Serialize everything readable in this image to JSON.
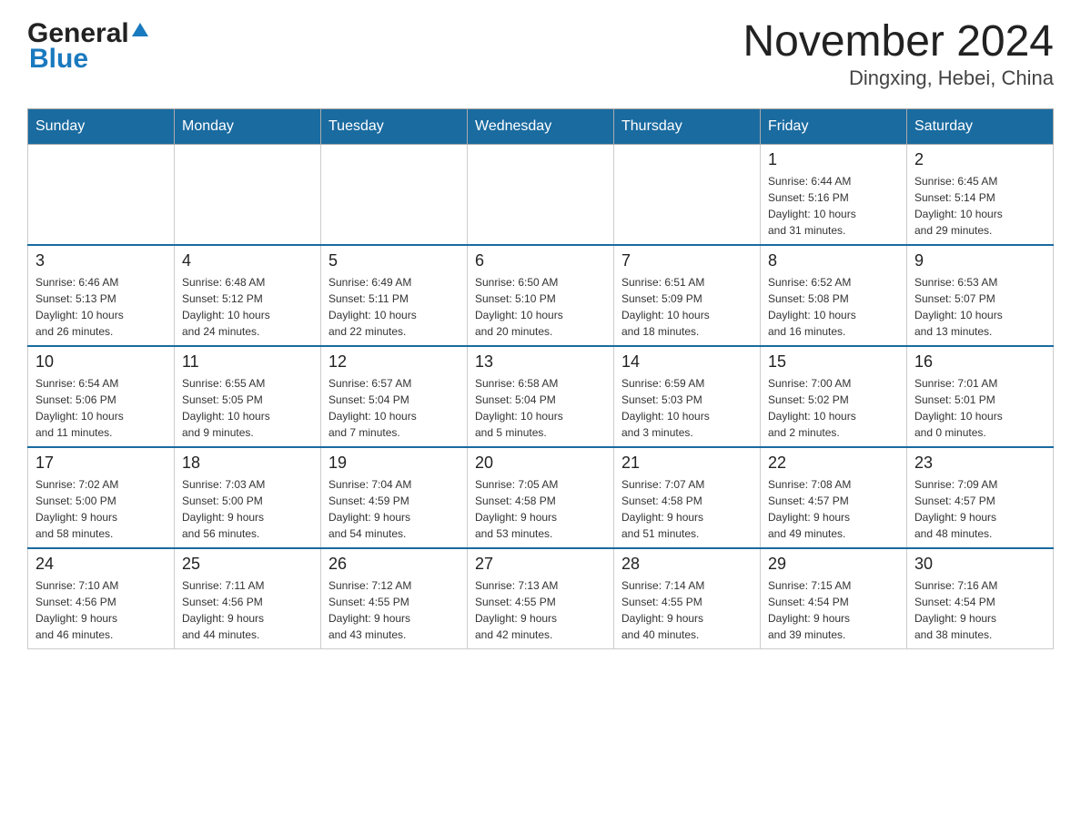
{
  "logo": {
    "general": "General",
    "blue": "Blue"
  },
  "title": "November 2024",
  "subtitle": "Dingxing, Hebei, China",
  "weekdays": [
    "Sunday",
    "Monday",
    "Tuesday",
    "Wednesday",
    "Thursday",
    "Friday",
    "Saturday"
  ],
  "weeks": [
    [
      {
        "day": "",
        "info": ""
      },
      {
        "day": "",
        "info": ""
      },
      {
        "day": "",
        "info": ""
      },
      {
        "day": "",
        "info": ""
      },
      {
        "day": "",
        "info": ""
      },
      {
        "day": "1",
        "info": "Sunrise: 6:44 AM\nSunset: 5:16 PM\nDaylight: 10 hours\nand 31 minutes."
      },
      {
        "day": "2",
        "info": "Sunrise: 6:45 AM\nSunset: 5:14 PM\nDaylight: 10 hours\nand 29 minutes."
      }
    ],
    [
      {
        "day": "3",
        "info": "Sunrise: 6:46 AM\nSunset: 5:13 PM\nDaylight: 10 hours\nand 26 minutes."
      },
      {
        "day": "4",
        "info": "Sunrise: 6:48 AM\nSunset: 5:12 PM\nDaylight: 10 hours\nand 24 minutes."
      },
      {
        "day": "5",
        "info": "Sunrise: 6:49 AM\nSunset: 5:11 PM\nDaylight: 10 hours\nand 22 minutes."
      },
      {
        "day": "6",
        "info": "Sunrise: 6:50 AM\nSunset: 5:10 PM\nDaylight: 10 hours\nand 20 minutes."
      },
      {
        "day": "7",
        "info": "Sunrise: 6:51 AM\nSunset: 5:09 PM\nDaylight: 10 hours\nand 18 minutes."
      },
      {
        "day": "8",
        "info": "Sunrise: 6:52 AM\nSunset: 5:08 PM\nDaylight: 10 hours\nand 16 minutes."
      },
      {
        "day": "9",
        "info": "Sunrise: 6:53 AM\nSunset: 5:07 PM\nDaylight: 10 hours\nand 13 minutes."
      }
    ],
    [
      {
        "day": "10",
        "info": "Sunrise: 6:54 AM\nSunset: 5:06 PM\nDaylight: 10 hours\nand 11 minutes."
      },
      {
        "day": "11",
        "info": "Sunrise: 6:55 AM\nSunset: 5:05 PM\nDaylight: 10 hours\nand 9 minutes."
      },
      {
        "day": "12",
        "info": "Sunrise: 6:57 AM\nSunset: 5:04 PM\nDaylight: 10 hours\nand 7 minutes."
      },
      {
        "day": "13",
        "info": "Sunrise: 6:58 AM\nSunset: 5:04 PM\nDaylight: 10 hours\nand 5 minutes."
      },
      {
        "day": "14",
        "info": "Sunrise: 6:59 AM\nSunset: 5:03 PM\nDaylight: 10 hours\nand 3 minutes."
      },
      {
        "day": "15",
        "info": "Sunrise: 7:00 AM\nSunset: 5:02 PM\nDaylight: 10 hours\nand 2 minutes."
      },
      {
        "day": "16",
        "info": "Sunrise: 7:01 AM\nSunset: 5:01 PM\nDaylight: 10 hours\nand 0 minutes."
      }
    ],
    [
      {
        "day": "17",
        "info": "Sunrise: 7:02 AM\nSunset: 5:00 PM\nDaylight: 9 hours\nand 58 minutes."
      },
      {
        "day": "18",
        "info": "Sunrise: 7:03 AM\nSunset: 5:00 PM\nDaylight: 9 hours\nand 56 minutes."
      },
      {
        "day": "19",
        "info": "Sunrise: 7:04 AM\nSunset: 4:59 PM\nDaylight: 9 hours\nand 54 minutes."
      },
      {
        "day": "20",
        "info": "Sunrise: 7:05 AM\nSunset: 4:58 PM\nDaylight: 9 hours\nand 53 minutes."
      },
      {
        "day": "21",
        "info": "Sunrise: 7:07 AM\nSunset: 4:58 PM\nDaylight: 9 hours\nand 51 minutes."
      },
      {
        "day": "22",
        "info": "Sunrise: 7:08 AM\nSunset: 4:57 PM\nDaylight: 9 hours\nand 49 minutes."
      },
      {
        "day": "23",
        "info": "Sunrise: 7:09 AM\nSunset: 4:57 PM\nDaylight: 9 hours\nand 48 minutes."
      }
    ],
    [
      {
        "day": "24",
        "info": "Sunrise: 7:10 AM\nSunset: 4:56 PM\nDaylight: 9 hours\nand 46 minutes."
      },
      {
        "day": "25",
        "info": "Sunrise: 7:11 AM\nSunset: 4:56 PM\nDaylight: 9 hours\nand 44 minutes."
      },
      {
        "day": "26",
        "info": "Sunrise: 7:12 AM\nSunset: 4:55 PM\nDaylight: 9 hours\nand 43 minutes."
      },
      {
        "day": "27",
        "info": "Sunrise: 7:13 AM\nSunset: 4:55 PM\nDaylight: 9 hours\nand 42 minutes."
      },
      {
        "day": "28",
        "info": "Sunrise: 7:14 AM\nSunset: 4:55 PM\nDaylight: 9 hours\nand 40 minutes."
      },
      {
        "day": "29",
        "info": "Sunrise: 7:15 AM\nSunset: 4:54 PM\nDaylight: 9 hours\nand 39 minutes."
      },
      {
        "day": "30",
        "info": "Sunrise: 7:16 AM\nSunset: 4:54 PM\nDaylight: 9 hours\nand 38 minutes."
      }
    ]
  ]
}
